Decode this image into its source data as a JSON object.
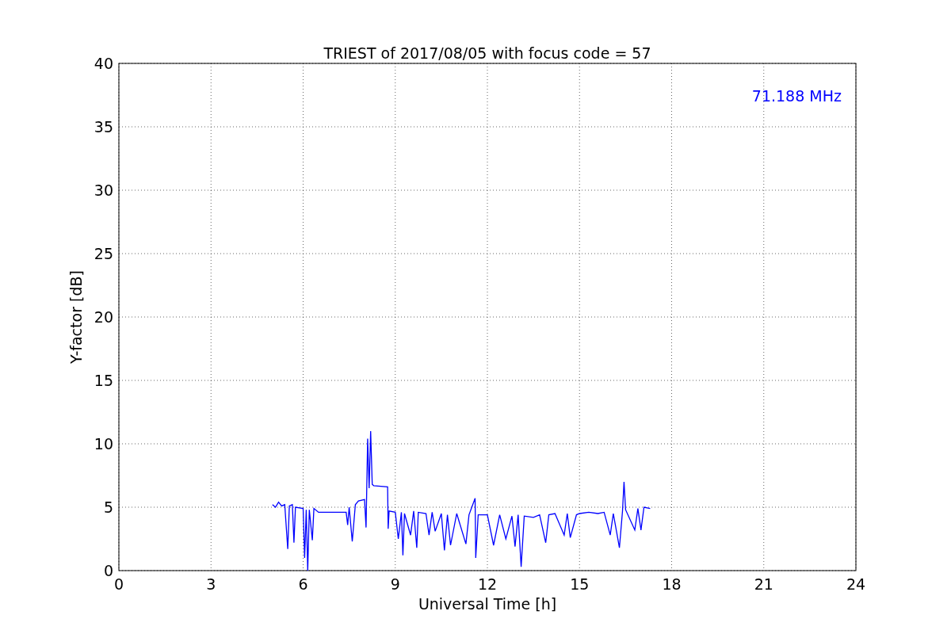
{
  "chart_data": {
    "type": "line",
    "title": "TRIEST of 2017/08/05 with focus code = 57",
    "xlabel": "Universal Time [h]",
    "ylabel": "Y-factor [dB]",
    "xlim": [
      0,
      24
    ],
    "ylim": [
      0,
      40
    ],
    "xticks": [
      0,
      3,
      6,
      9,
      12,
      15,
      18,
      21,
      24
    ],
    "yticks": [
      0,
      5,
      10,
      15,
      20,
      25,
      30,
      35,
      40
    ],
    "x": [
      5.0,
      5.1,
      5.2,
      5.3,
      5.4,
      5.5,
      5.55,
      5.65,
      5.7,
      5.75,
      6.0,
      6.05,
      6.1,
      6.15,
      6.2,
      6.3,
      6.35,
      6.5,
      7.4,
      7.45,
      7.5,
      7.6,
      7.7,
      7.8,
      8.0,
      8.05,
      8.1,
      8.15,
      8.2,
      8.25,
      8.3,
      8.75,
      8.77,
      8.8,
      9.0,
      9.1,
      9.2,
      9.25,
      9.3,
      9.5,
      9.6,
      9.7,
      9.75,
      10.0,
      10.1,
      10.2,
      10.3,
      10.5,
      10.6,
      10.7,
      10.8,
      11.0,
      11.3,
      11.4,
      11.6,
      11.62,
      11.7,
      12.0,
      12.2,
      12.4,
      12.6,
      12.8,
      12.9,
      13.0,
      13.1,
      13.2,
      13.5,
      13.7,
      13.9,
      14.0,
      14.2,
      14.5,
      14.6,
      14.7,
      14.9,
      15.0,
      15.3,
      15.6,
      15.8,
      16.0,
      16.1,
      16.3,
      16.4,
      16.45,
      16.5,
      16.8,
      16.9,
      17.0,
      17.1,
      17.3
    ],
    "series": [
      {
        "color": "#0000ff",
        "values": [
          5.2,
          5.0,
          5.4,
          5.1,
          5.2,
          1.7,
          5.1,
          5.2,
          2.2,
          5.0,
          4.9,
          1.0,
          4.8,
          0,
          4.8,
          2.4,
          4.9,
          4.6,
          4.6,
          3.6,
          5.0,
          2.3,
          5.2,
          5.5,
          5.6,
          3.4,
          10.4,
          6.5,
          11.0,
          6.8,
          6.7,
          6.6,
          3.3,
          4.7,
          4.6,
          2.5,
          4.6,
          1.2,
          4.5,
          2.8,
          4.7,
          1.8,
          4.6,
          4.5,
          2.8,
          4.6,
          3.1,
          4.5,
          1.6,
          4.4,
          2.0,
          4.5,
          2.1,
          4.4,
          5.7,
          1.0,
          4.4,
          4.4,
          2.0,
          4.4,
          2.5,
          4.3,
          1.9,
          4.4,
          0.3,
          4.3,
          4.2,
          4.4,
          2.2,
          4.4,
          4.5,
          2.8,
          4.5,
          2.6,
          4.4,
          4.5,
          4.6,
          4.5,
          4.6,
          2.8,
          4.5,
          1.8,
          4.7,
          7.0,
          4.8,
          3.2,
          4.9,
          3.2,
          5.0,
          4.9
        ]
      }
    ],
    "grid": true,
    "annotations": [
      {
        "text": "71.188 MHz"
      }
    ]
  }
}
